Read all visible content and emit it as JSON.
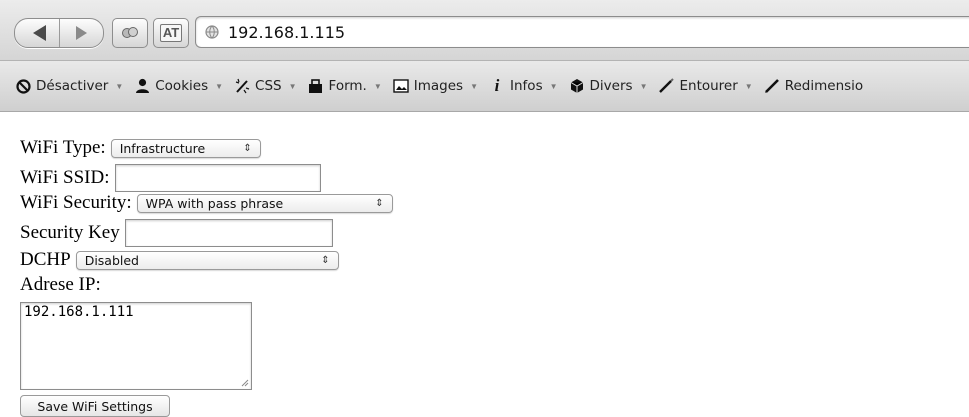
{
  "browser": {
    "url": "192.168.1.115",
    "nav": {
      "back_icon": "back-arrow-icon",
      "forward_icon": "forward-arrow-icon"
    },
    "toolbar_buttons": [
      {
        "icon": "extension-icon"
      },
      {
        "icon": "at-icon",
        "glyph": "AT"
      }
    ]
  },
  "devbar": {
    "items": [
      {
        "label": "Désactiver",
        "icon": "disable-icon"
      },
      {
        "label": "Cookies",
        "icon": "user-icon"
      },
      {
        "label": "CSS",
        "icon": "css-pen-icon"
      },
      {
        "label": "Form.",
        "icon": "form-icon"
      },
      {
        "label": "Images",
        "icon": "images-icon"
      },
      {
        "label": "Infos",
        "icon": "info-icon"
      },
      {
        "label": "Divers",
        "icon": "misc-icon"
      },
      {
        "label": "Entourer",
        "icon": "outline-icon"
      },
      {
        "label": "Redimensio",
        "icon": "resize-icon"
      }
    ]
  },
  "form": {
    "wifi_type": {
      "label": "WiFi Type:",
      "value": "Infrastructure",
      "arrow": "⇕"
    },
    "wifi_ssid": {
      "label": "WiFi SSID:",
      "value": ""
    },
    "wifi_security": {
      "label": "WiFi Security:",
      "value": "WPA with pass phrase",
      "arrow": "⇕"
    },
    "security_key": {
      "label": "Security Key",
      "value": ""
    },
    "dhcp": {
      "label": "DCHP",
      "value": "Disabled",
      "arrow": "⇕"
    },
    "ip": {
      "label": "Adrese IP:",
      "value": "192.168.1.111"
    },
    "save_label": "Save WiFi Settings"
  }
}
